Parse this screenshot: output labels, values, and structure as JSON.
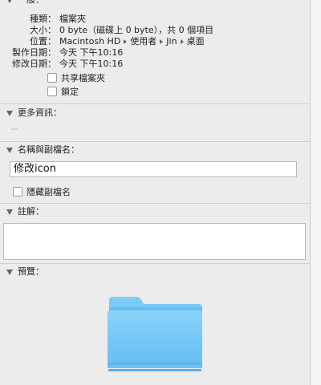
{
  "general": {
    "header": "一般：",
    "kind_label": "種類：",
    "kind_value": "檔案夾",
    "size_label": "大小：",
    "size_value": "0 byte（磁碟上 0 byte），共 0 個項目",
    "location_label": "位置：",
    "location_path": [
      "Macintosh HD",
      "使用者",
      "Jin",
      "桌面"
    ],
    "created_label": "製作日期：",
    "created_value": "今天 下午10:16",
    "modified_label": "修改日期：",
    "modified_value": "今天 下午10:16",
    "shared_folder": "共享檔案夾",
    "locked": "鎖定"
  },
  "more_info": {
    "header": "更多資訊：",
    "placeholder": "--"
  },
  "name_extension": {
    "header": "名稱與副檔名：",
    "name_value": "修改icon",
    "hide_extension": "隱藏副檔名"
  },
  "comments": {
    "header": "註解：",
    "value": ""
  },
  "preview": {
    "header": "預覽：",
    "icon": "folder-icon",
    "folder_color": "#6cc2f5"
  }
}
